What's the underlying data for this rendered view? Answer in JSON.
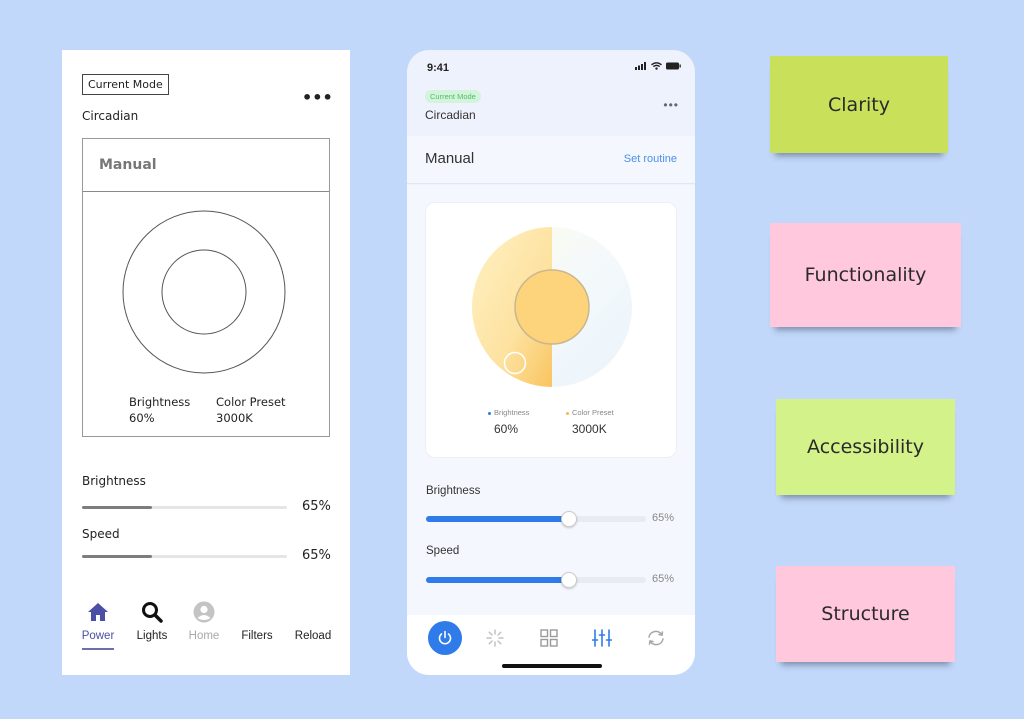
{
  "wireframe": {
    "current_mode_label": "Current Mode",
    "more_label": "•••",
    "mode_value": "Circadian",
    "card_title": "Manual",
    "stats": [
      {
        "label": "Brightness",
        "value": "60%"
      },
      {
        "label": "Color Preset",
        "value": "3000K"
      }
    ],
    "sliders": [
      {
        "label": "Brightness",
        "value_text": "65%",
        "fill_fraction": 0.34
      },
      {
        "label": "Speed",
        "value_text": "65%",
        "fill_fraction": 0.34
      }
    ],
    "nav": [
      {
        "label": "Power",
        "icon": "home-icon",
        "active": true
      },
      {
        "label": "Lights",
        "icon": "search-icon",
        "active": false
      },
      {
        "label": "Home",
        "icon": "user-icon",
        "active": false
      },
      {
        "label": "Filters",
        "icon": "",
        "active": false
      },
      {
        "label": "Reload",
        "icon": "",
        "active": false
      }
    ],
    "colors": {
      "active_nav": "#4b4fa6",
      "inactive_nav_disabled": "#a9a9a9"
    }
  },
  "phone": {
    "status_time": "9:41",
    "status_icons": [
      "signal-icon",
      "wifi-icon",
      "battery-icon"
    ],
    "mode_badge": "Current Mode",
    "mode_value": "Circadian",
    "more_label": "•••",
    "section_title": "Manual",
    "section_link": "Set routine",
    "stats": [
      {
        "label": "Brightness",
        "value": "60%",
        "dot_color": "#2f7be9"
      },
      {
        "label": "Color Preset",
        "value": "3000K",
        "dot_color": "#f5b94a"
      }
    ],
    "sliders": [
      {
        "label": "Brightness",
        "value_text": "65%",
        "value": 0.65
      },
      {
        "label": "Speed",
        "value_text": "65%",
        "value": 0.65
      }
    ],
    "tabs": [
      {
        "icon": "power-icon",
        "active": true
      },
      {
        "icon": "loading-icon",
        "active": false
      },
      {
        "icon": "grid-icon",
        "active": false
      },
      {
        "icon": "sliders-icon",
        "active": false
      },
      {
        "icon": "refresh-icon",
        "active": false
      }
    ],
    "colors": {
      "accent": "#2f7be9",
      "badge_bg": "#d3f3da",
      "badge_text": "#4fbf6b"
    }
  },
  "notes": [
    {
      "label": "Clarity",
      "color": "#c9e05a"
    },
    {
      "label": "Functionality",
      "color": "#ffc8dc"
    },
    {
      "label": "Accessibility",
      "color": "#d4f28a"
    },
    {
      "label": "Structure",
      "color": "#ffc8dc"
    }
  ],
  "background_color": "#c2d8fa"
}
